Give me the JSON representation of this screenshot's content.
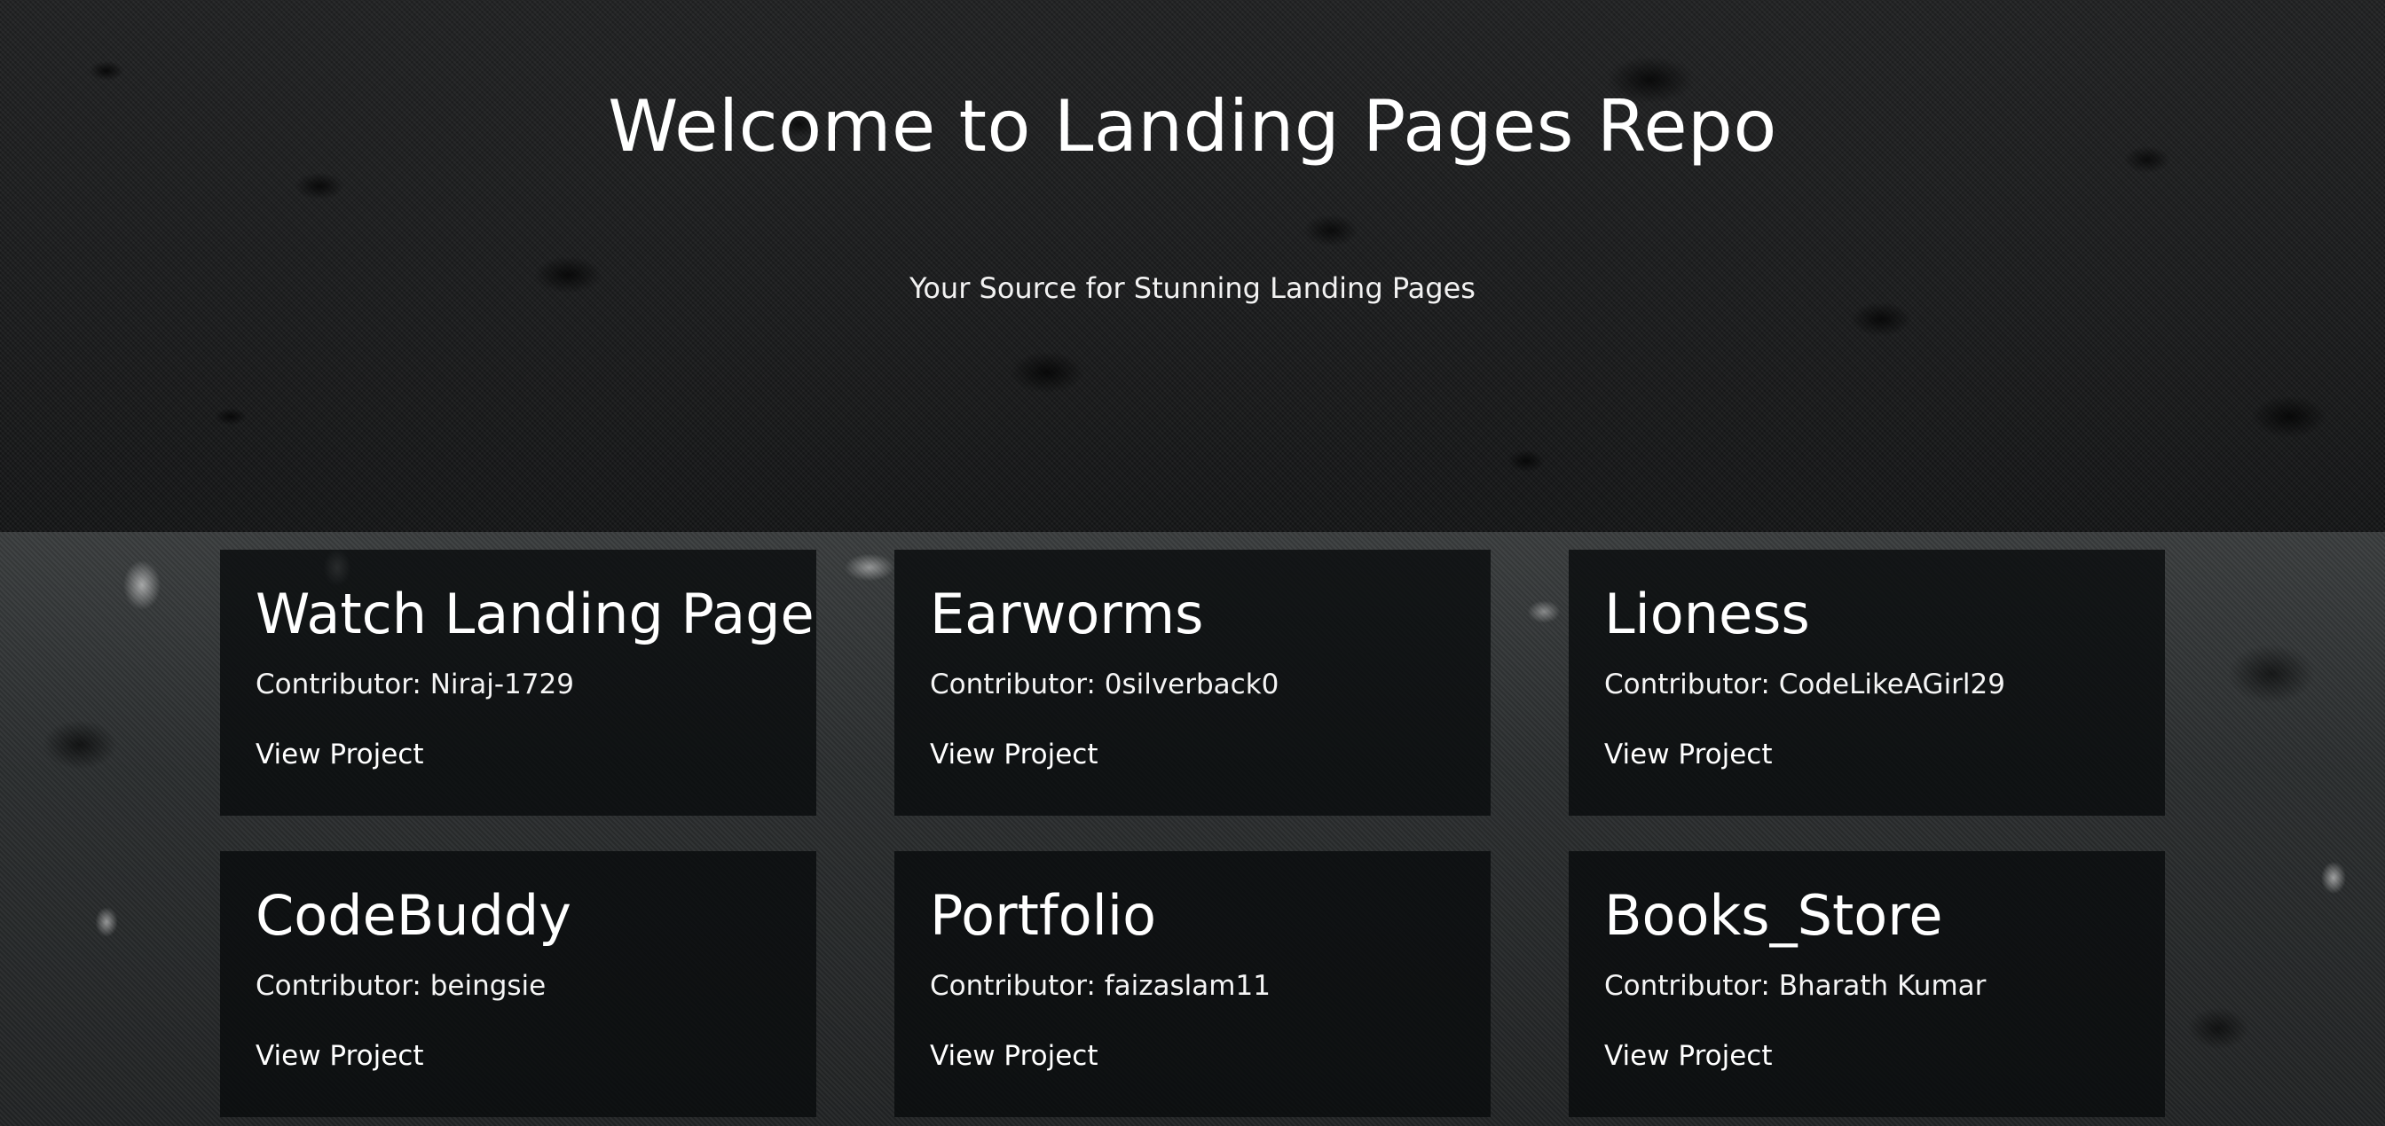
{
  "hero": {
    "title": "Welcome to Landing Pages Repo",
    "subtitle": "Your Source for Stunning Landing Pages"
  },
  "projects": [
    {
      "title": "Watch Landing Page",
      "contributor": "Contributor: Niraj-1729",
      "link_label": "View Project"
    },
    {
      "title": "Earworms",
      "contributor": "Contributor: 0silverback0",
      "link_label": "View Project"
    },
    {
      "title": "Lioness",
      "contributor": "Contributor: CodeLikeAGirl29",
      "link_label": "View Project"
    },
    {
      "title": "CodeBuddy",
      "contributor": "Contributor: beingsie",
      "link_label": "View Project"
    },
    {
      "title": "Portfolio",
      "contributor": "Contributor: faizaslam11",
      "link_label": "View Project"
    },
    {
      "title": "Books_Store",
      "contributor": "Contributor: Bharath Kumar",
      "link_label": "View Project"
    }
  ],
  "colors": {
    "text": "#ffffff",
    "card_background": "#080a0b",
    "page_background": "#1b1c1d"
  }
}
